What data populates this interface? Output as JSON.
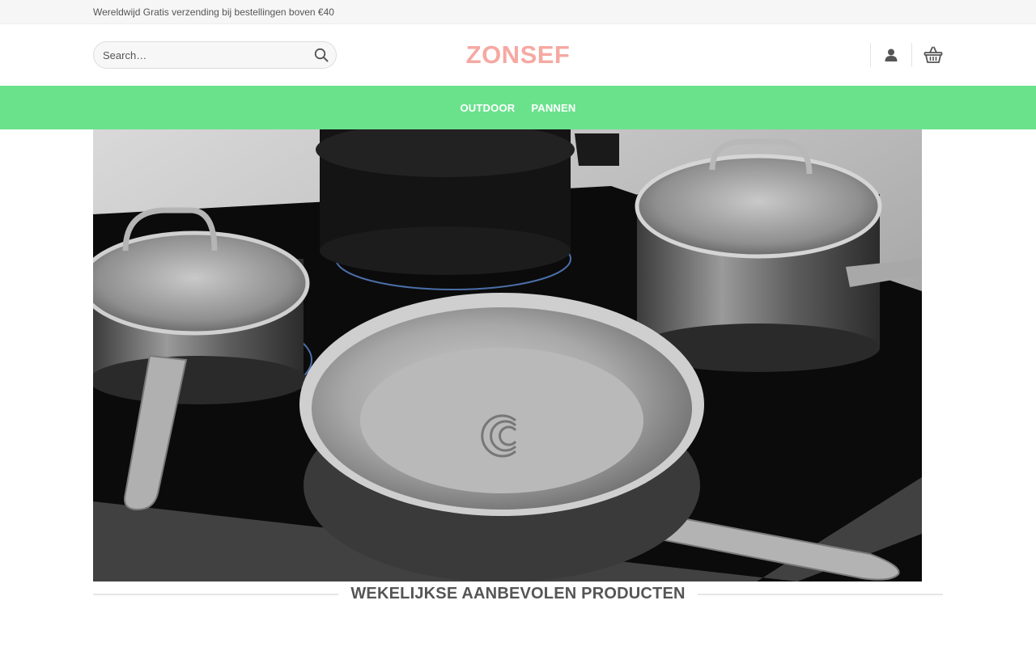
{
  "topbar": {
    "message": "Wereldwijd Gratis verzending bij bestellingen boven €40"
  },
  "header": {
    "search_placeholder": "Search…",
    "logo": "ZONSEF",
    "icons": [
      "search-icon",
      "user-icon",
      "basket-icon"
    ]
  },
  "nav": {
    "items": [
      {
        "label": "OUTDOOR"
      },
      {
        "label": "PANNEN"
      }
    ]
  },
  "featured": {
    "title": "WEKELIJKSE AANBEVOLEN PRODUCTEN"
  },
  "colors": {
    "nav_bg": "#6ae28c",
    "logo": "#f5a9a2",
    "topbar_bg": "#f6f6f6"
  }
}
